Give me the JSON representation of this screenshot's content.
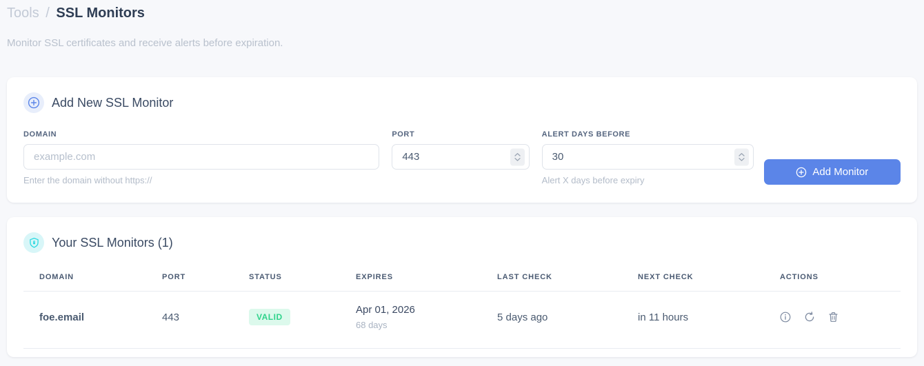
{
  "breadcrumb": {
    "parent": "Tools",
    "separator": "/",
    "current": "SSL Monitors"
  },
  "subtitle": "Monitor SSL certificates and receive alerts before expiration.",
  "add_card": {
    "title": "Add New SSL Monitor",
    "fields": {
      "domain": {
        "label": "DOMAIN",
        "placeholder": "example.com",
        "value": "",
        "helper": "Enter the domain without https://"
      },
      "port": {
        "label": "PORT",
        "value": "443"
      },
      "alert_days": {
        "label": "ALERT DAYS BEFORE",
        "value": "30",
        "helper": "Alert X days before expiry"
      }
    },
    "submit_label": "Add Monitor"
  },
  "monitors_card": {
    "title": "Your SSL Monitors (1)",
    "count": 1,
    "table": {
      "headers": [
        "DOMAIN",
        "PORT",
        "STATUS",
        "EXPIRES",
        "LAST CHECK",
        "NEXT CHECK",
        "ACTIONS"
      ],
      "rows": [
        {
          "domain": "foe.email",
          "port": "443",
          "status": "VALID",
          "expires_date": "Apr 01, 2026",
          "expires_days": "68 days",
          "last_check": "5 days ago",
          "next_check": "in 11 hours"
        }
      ]
    }
  },
  "icons": {
    "header_add": "plus-circle-icon",
    "header_shield": "shield-lock-icon",
    "row_actions": [
      "info-icon",
      "refresh-icon",
      "trash-icon"
    ]
  },
  "colors": {
    "accent_blue": "#5b85e8",
    "accent_cyan": "#2bd9e0",
    "badge_green_text": "#2fd38b",
    "badge_green_bg": "#dcf9ec",
    "page_bg": "#f7f8fb",
    "card_bg": "#ffffff",
    "heading_dark": "#2e3d54",
    "muted_gray": "#b9c1cd"
  }
}
